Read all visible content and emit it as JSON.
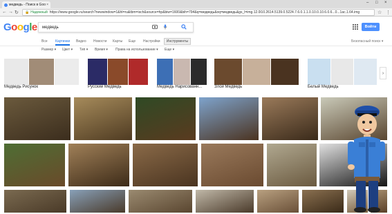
{
  "browser": {
    "tab_title": "медведь - Поиск в Goo",
    "tab_close": "×",
    "window_controls": [
      "–",
      "□",
      "×"
    ],
    "secure_label": "Надежный",
    "url": "https://www.google.ru/search?newwindow=1&hl=ru&tbm=isch&source=hp&biw=1600&bih=794&q=медведь&oq=медведь&gs_l=img.12.0l10.2614.5139.0.5224.7.6.0.1.1.0.10.0.10.6.0.6...0...1ac.1.64.img",
    "nav": {
      "back": "←",
      "forward": "→",
      "reload": "↻"
    },
    "bookmark_icon": "☆",
    "menu_icon": "⋮"
  },
  "google": {
    "logo_letters": [
      {
        "ch": "G",
        "color": "#4285f4"
      },
      {
        "ch": "o",
        "color": "#ea4335"
      },
      {
        "ch": "o",
        "color": "#fbbc05"
      },
      {
        "ch": "g",
        "color": "#4285f4"
      },
      {
        "ch": "l",
        "color": "#34a853"
      },
      {
        "ch": "e",
        "color": "#ea4335"
      }
    ],
    "query": "медведь",
    "signin": "Войти",
    "tabs": [
      {
        "label": "Все",
        "active": false
      },
      {
        "label": "Картинки",
        "active": true
      },
      {
        "label": "Видео",
        "active": false
      },
      {
        "label": "Новости",
        "active": false
      },
      {
        "label": "Карты",
        "active": false
      },
      {
        "label": "Еще",
        "active": false
      },
      {
        "label": "Настройки",
        "active": false
      }
    ],
    "tools_label": "Инструменты",
    "safesearch": "Безопасный поиск ▾",
    "filters": [
      "Размер ▾",
      "Цвет ▾",
      "Тип ▾",
      "Время ▾",
      "Права на использование ▾",
      "Еще ▾"
    ]
  },
  "related": [
    {
      "caption": "Медведь Рисунок",
      "colors": [
        "#e9e9e9",
        "#a18c77",
        "#ececec"
      ]
    },
    {
      "caption": "Русский Медведь",
      "colors": [
        "#2b2b66",
        "#8a4a2a",
        "#b02a2a"
      ]
    },
    {
      "caption": "Медведь Нарисованн...",
      "colors": [
        "#3d6fb5",
        "#c9b8b0",
        "#2b2b2b"
      ]
    },
    {
      "caption": "Злой Медведь",
      "colors": [
        "#6b4a2e",
        "#c7b09a",
        "#4a3320"
      ]
    },
    {
      "caption": "Белый Медведь",
      "colors": [
        "#c9dff0",
        "#e8e8e8",
        "#dfe9f2"
      ]
    }
  ],
  "next_icon": "›",
  "results": [
    {
      "c1": "#6b5a3d",
      "c2": "#3b2d1d"
    },
    {
      "c1": "#a68b5b",
      "c2": "#4f3b22"
    },
    {
      "c1": "#2f4a25",
      "c2": "#5a3a1f"
    },
    {
      "c1": "#7ea3cc",
      "c2": "#4b3320"
    },
    {
      "c1": "#9a7a5a",
      "c2": "#3a2a1a"
    },
    {
      "c1": "#c9c9b8",
      "c2": "#5a4630"
    },
    {
      "c1": "#4e6e34",
      "c2": "#6a4a2a"
    },
    {
      "c1": "#a08058",
      "c2": "#3d2b18"
    },
    {
      "c1": "#8a6a48",
      "c2": "#4a3420"
    },
    {
      "c1": "#9a7a5c",
      "c2": "#6a4a30"
    },
    {
      "c1": "#b0a890",
      "c2": "#6b5a40"
    },
    {
      "c1": "#e0e0e0",
      "c2": "#151515"
    },
    {
      "c1": "#7a6a50",
      "c2": "#4a3a28"
    },
    {
      "c1": "#88a0b8",
      "c2": "#4a3a2a"
    },
    {
      "c1": "#9a8a70",
      "c2": "#5a4630"
    },
    {
      "c1": "#c0b8a8",
      "c2": "#4a3a2a"
    },
    {
      "c1": "#b8a080",
      "c2": "#6a5038"
    },
    {
      "c1": "#8a7050",
      "c2": "#3a2a18"
    },
    {
      "c1": "#d0c8b8",
      "c2": "#7a6040"
    },
    {
      "c1": "#a89070",
      "c2": "#5a4028"
    }
  ]
}
